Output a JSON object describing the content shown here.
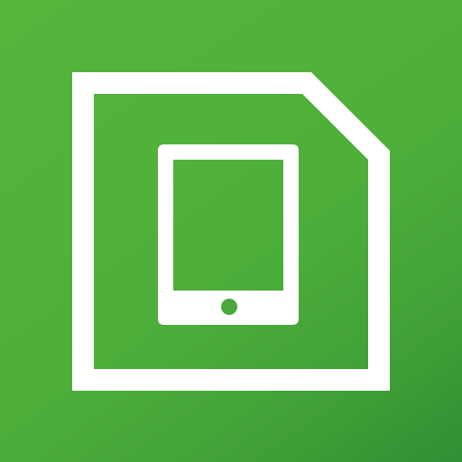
{
  "icon": {
    "name": "sim-card-tablet-icon",
    "depicts": [
      "sim-card-outline",
      "tablet-device"
    ],
    "colors": {
      "background_top": "#55b43c",
      "background_bottom": "#2f8f33",
      "foreground": "#ffffff"
    }
  }
}
